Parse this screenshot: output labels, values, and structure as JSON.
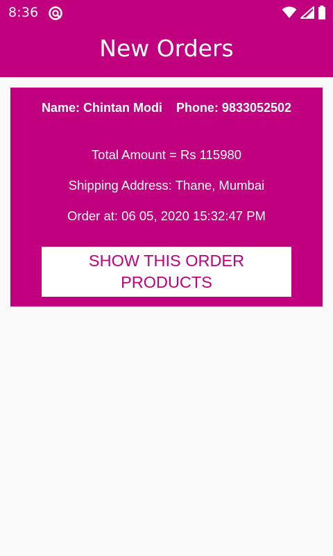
{
  "status_bar": {
    "time": "8:36",
    "icons": [
      "notification-icon",
      "wifi-icon",
      "signal-icon",
      "battery-icon"
    ]
  },
  "app_bar": {
    "title": "New Orders"
  },
  "order": {
    "name": "Name: Chintan Modi",
    "phone": "Phone: 9833052502",
    "total": "Total Amount = Rs 115980",
    "address": "Shipping Address: Thane, Mumbai",
    "date": "Order at: 06 05, 2020 15:32:47 PM",
    "button_label": "SHOW THIS ORDER PRODUCTS"
  },
  "colors": {
    "primary": "#c0007e",
    "background": "#fafafa",
    "button_bg": "#ffffff"
  }
}
